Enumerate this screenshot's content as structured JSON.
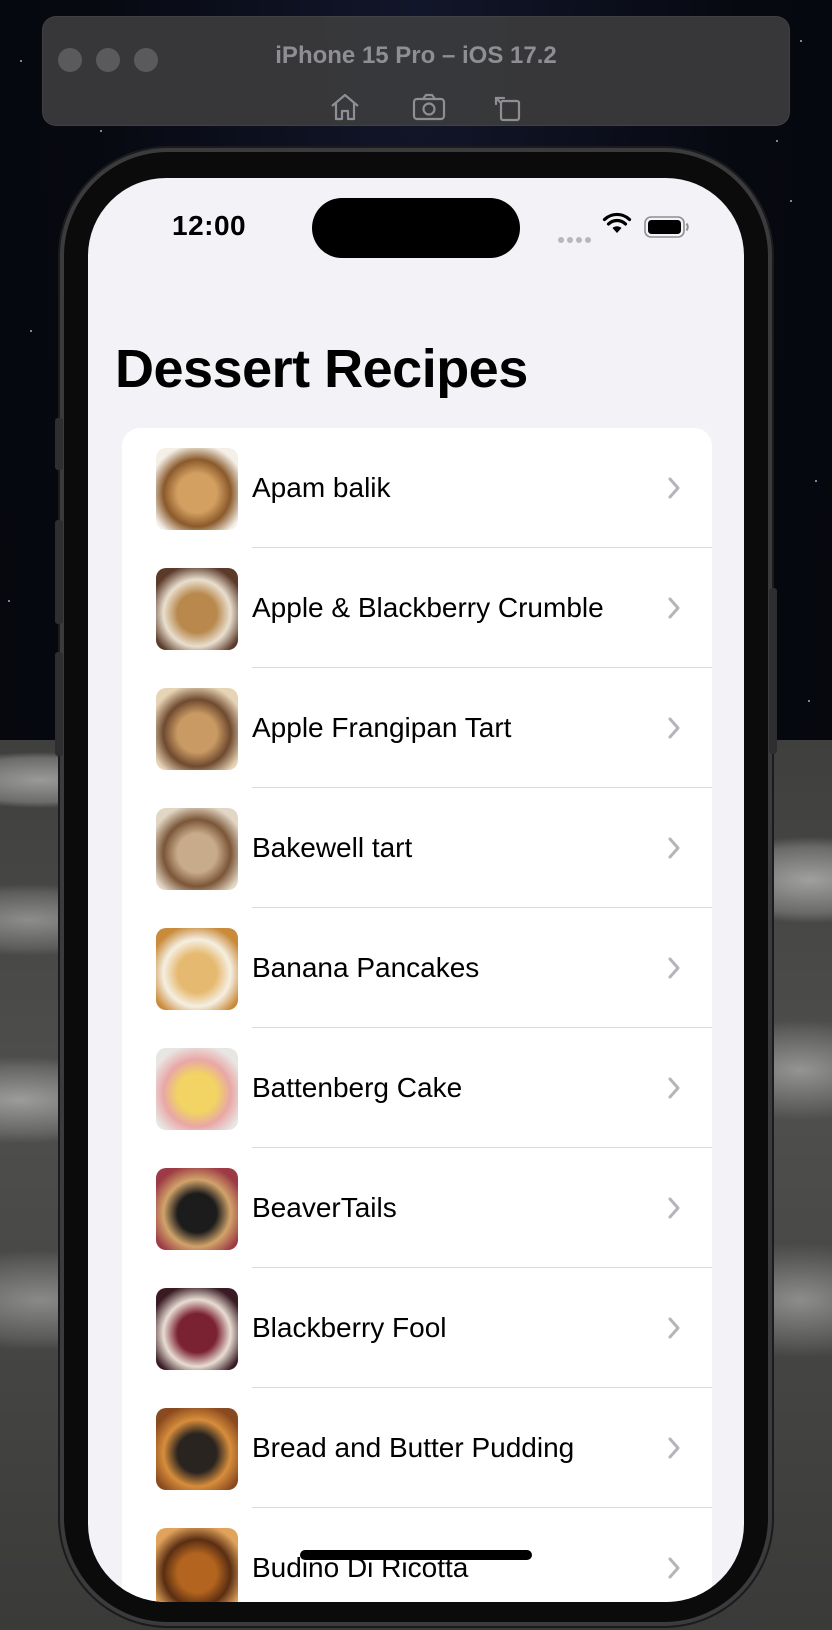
{
  "simulator": {
    "title": "iPhone 15 Pro – iOS 17.2",
    "tools": [
      "home-icon",
      "screenshot-icon",
      "rotate-icon"
    ]
  },
  "status_bar": {
    "time": "12:00",
    "icons": [
      "cellular-signal-icon",
      "wifi-icon",
      "battery-icon"
    ]
  },
  "navigation": {
    "title": "Dessert Recipes"
  },
  "recipes": [
    {
      "name": "Apam balik",
      "thumb_colors": [
        "#d4a061",
        "#8a5a2b",
        "#f4efe7"
      ]
    },
    {
      "name": "Apple & Blackberry Crumble",
      "thumb_colors": [
        "#b8884d",
        "#e9dfcf",
        "#5b3a2a"
      ]
    },
    {
      "name": "Apple Frangipan Tart",
      "thumb_colors": [
        "#c99a63",
        "#6f4a2f",
        "#e7d3b5"
      ]
    },
    {
      "name": "Bakewell tart",
      "thumb_colors": [
        "#c7ab8b",
        "#7b5638",
        "#e2d6c4"
      ]
    },
    {
      "name": "Banana Pancakes",
      "thumb_colors": [
        "#e6b970",
        "#f5efe2",
        "#c98a3a"
      ]
    },
    {
      "name": "Battenberg Cake",
      "thumb_colors": [
        "#f1d463",
        "#e9a7a6",
        "#e8e6e3"
      ]
    },
    {
      "name": "BeaverTails",
      "thumb_colors": [
        "#1c1c1c",
        "#d1a36a",
        "#9c3b45"
      ]
    },
    {
      "name": "Blackberry Fool",
      "thumb_colors": [
        "#7b2232",
        "#e8ddd3",
        "#3a1b24"
      ]
    },
    {
      "name": "Bread and Butter Pudding",
      "thumb_colors": [
        "#2a2420",
        "#d78d3c",
        "#8a4a1f"
      ]
    },
    {
      "name": "Budino Di Ricotta",
      "thumb_colors": [
        "#b3641f",
        "#5a2e12",
        "#e1a35b"
      ]
    }
  ]
}
